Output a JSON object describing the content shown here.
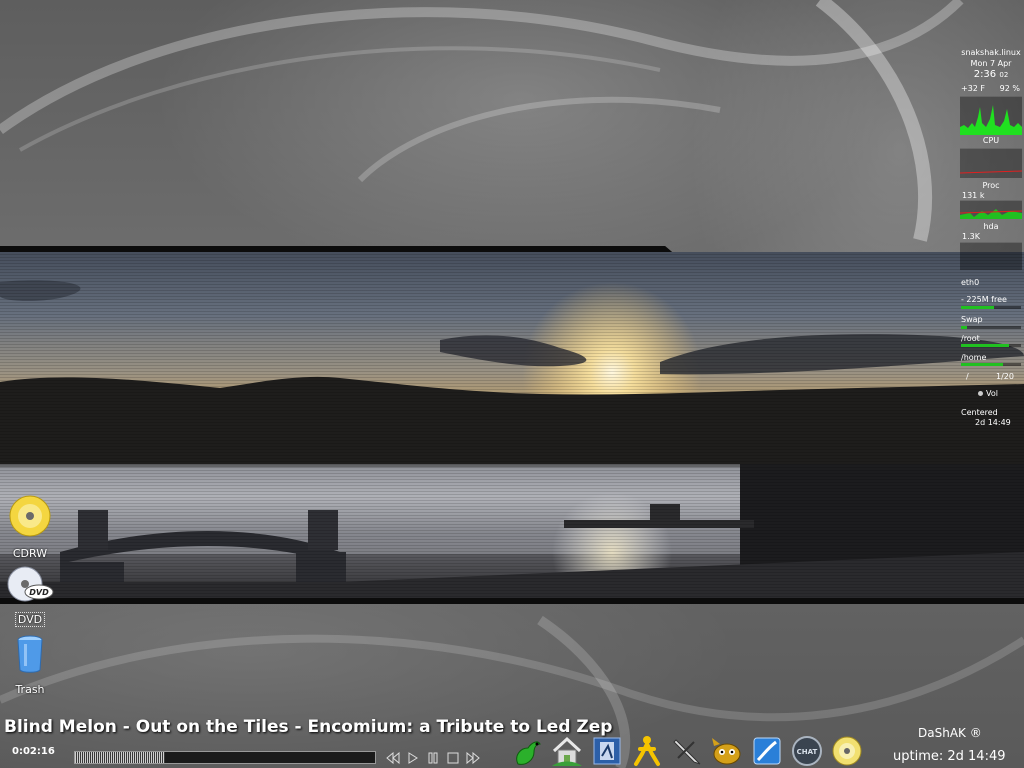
{
  "desktop": {
    "icons": [
      {
        "label": "CDRW"
      },
      {
        "label": "DVD"
      },
      {
        "label": "Trash"
      }
    ]
  },
  "monitor": {
    "hostname": "snakshak.linux",
    "date": "Mon  7  Apr",
    "time": "2:36",
    "seconds": "02",
    "temp": "+32 F",
    "humidity": "92 %",
    "cpu_label": "CPU",
    "proc_label": "Proc",
    "proc_value": "131 k",
    "hda_label": "hda",
    "hda_value": "1.3K",
    "eth_label": "eth0",
    "mem_label": "- 225M free",
    "swap_label": "Swap",
    "root_label": "/root",
    "home_label": "/home",
    "track_pos": "/",
    "track_count": "1/20",
    "vol_label": "Vol",
    "layout_mode": "Centered",
    "uptime_short": "2d 14:49"
  },
  "player": {
    "now_playing": "Blind Melon - Out on the Tiles - Encomium: a Tribute to Led Zep",
    "elapsed": "0:02:16",
    "progress_fraction": 0.3
  },
  "launcher": {
    "items": [
      "gecko-icon",
      "home-icon",
      "mail-icon",
      "aim-icon",
      "pen-icon",
      "gimp-icon",
      "editor-icon",
      "chat-icon",
      "cd-player-icon"
    ]
  },
  "status": {
    "user": "DaShAK  ®",
    "uptime": "uptime:  2d 14:49"
  },
  "colors": {
    "monitor_graph": "#20e020",
    "monitor_alert": "#e02020"
  }
}
